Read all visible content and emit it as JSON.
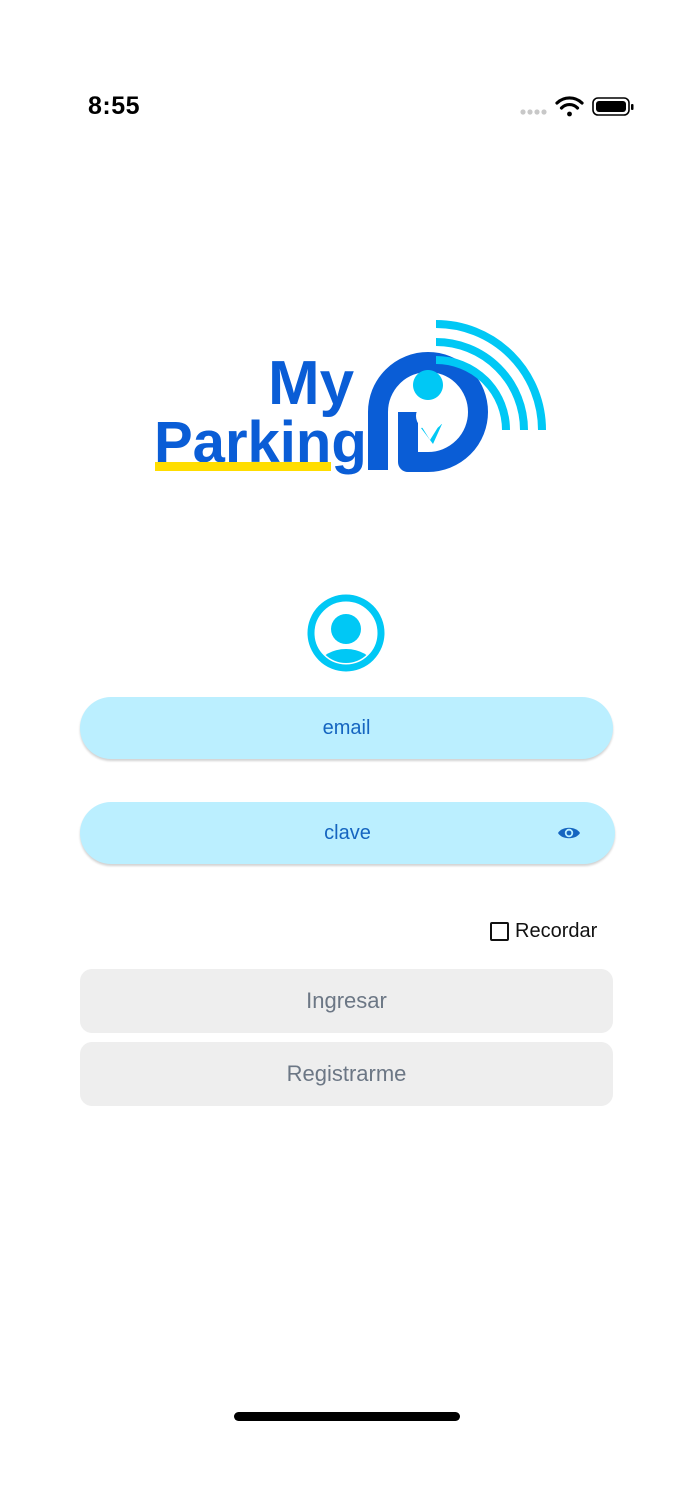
{
  "status_bar": {
    "time": "8:55",
    "icons": [
      "signal-icon",
      "wifi-icon",
      "battery-icon"
    ]
  },
  "logo": {
    "text_line1": "My",
    "text_line2": "Parking",
    "colors": {
      "primary": "#0a5dd6",
      "accent_cyan": "#00c8f5",
      "underline_yellow": "#ffdd00"
    }
  },
  "avatar": {
    "icon": "user-avatar-icon",
    "color": "#00c8f5"
  },
  "form": {
    "email": {
      "placeholder": "email"
    },
    "password": {
      "placeholder": "clave",
      "toggle_icon": "eye-icon"
    },
    "remember": {
      "label": "Recordar",
      "checked": false
    }
  },
  "buttons": {
    "login_label": "Ingresar",
    "register_label": "Registrarme"
  },
  "colors": {
    "field_bg": "#bbefff",
    "field_text": "#1565c0",
    "button_bg": "#eeeeee",
    "button_text": "#6c7785"
  }
}
